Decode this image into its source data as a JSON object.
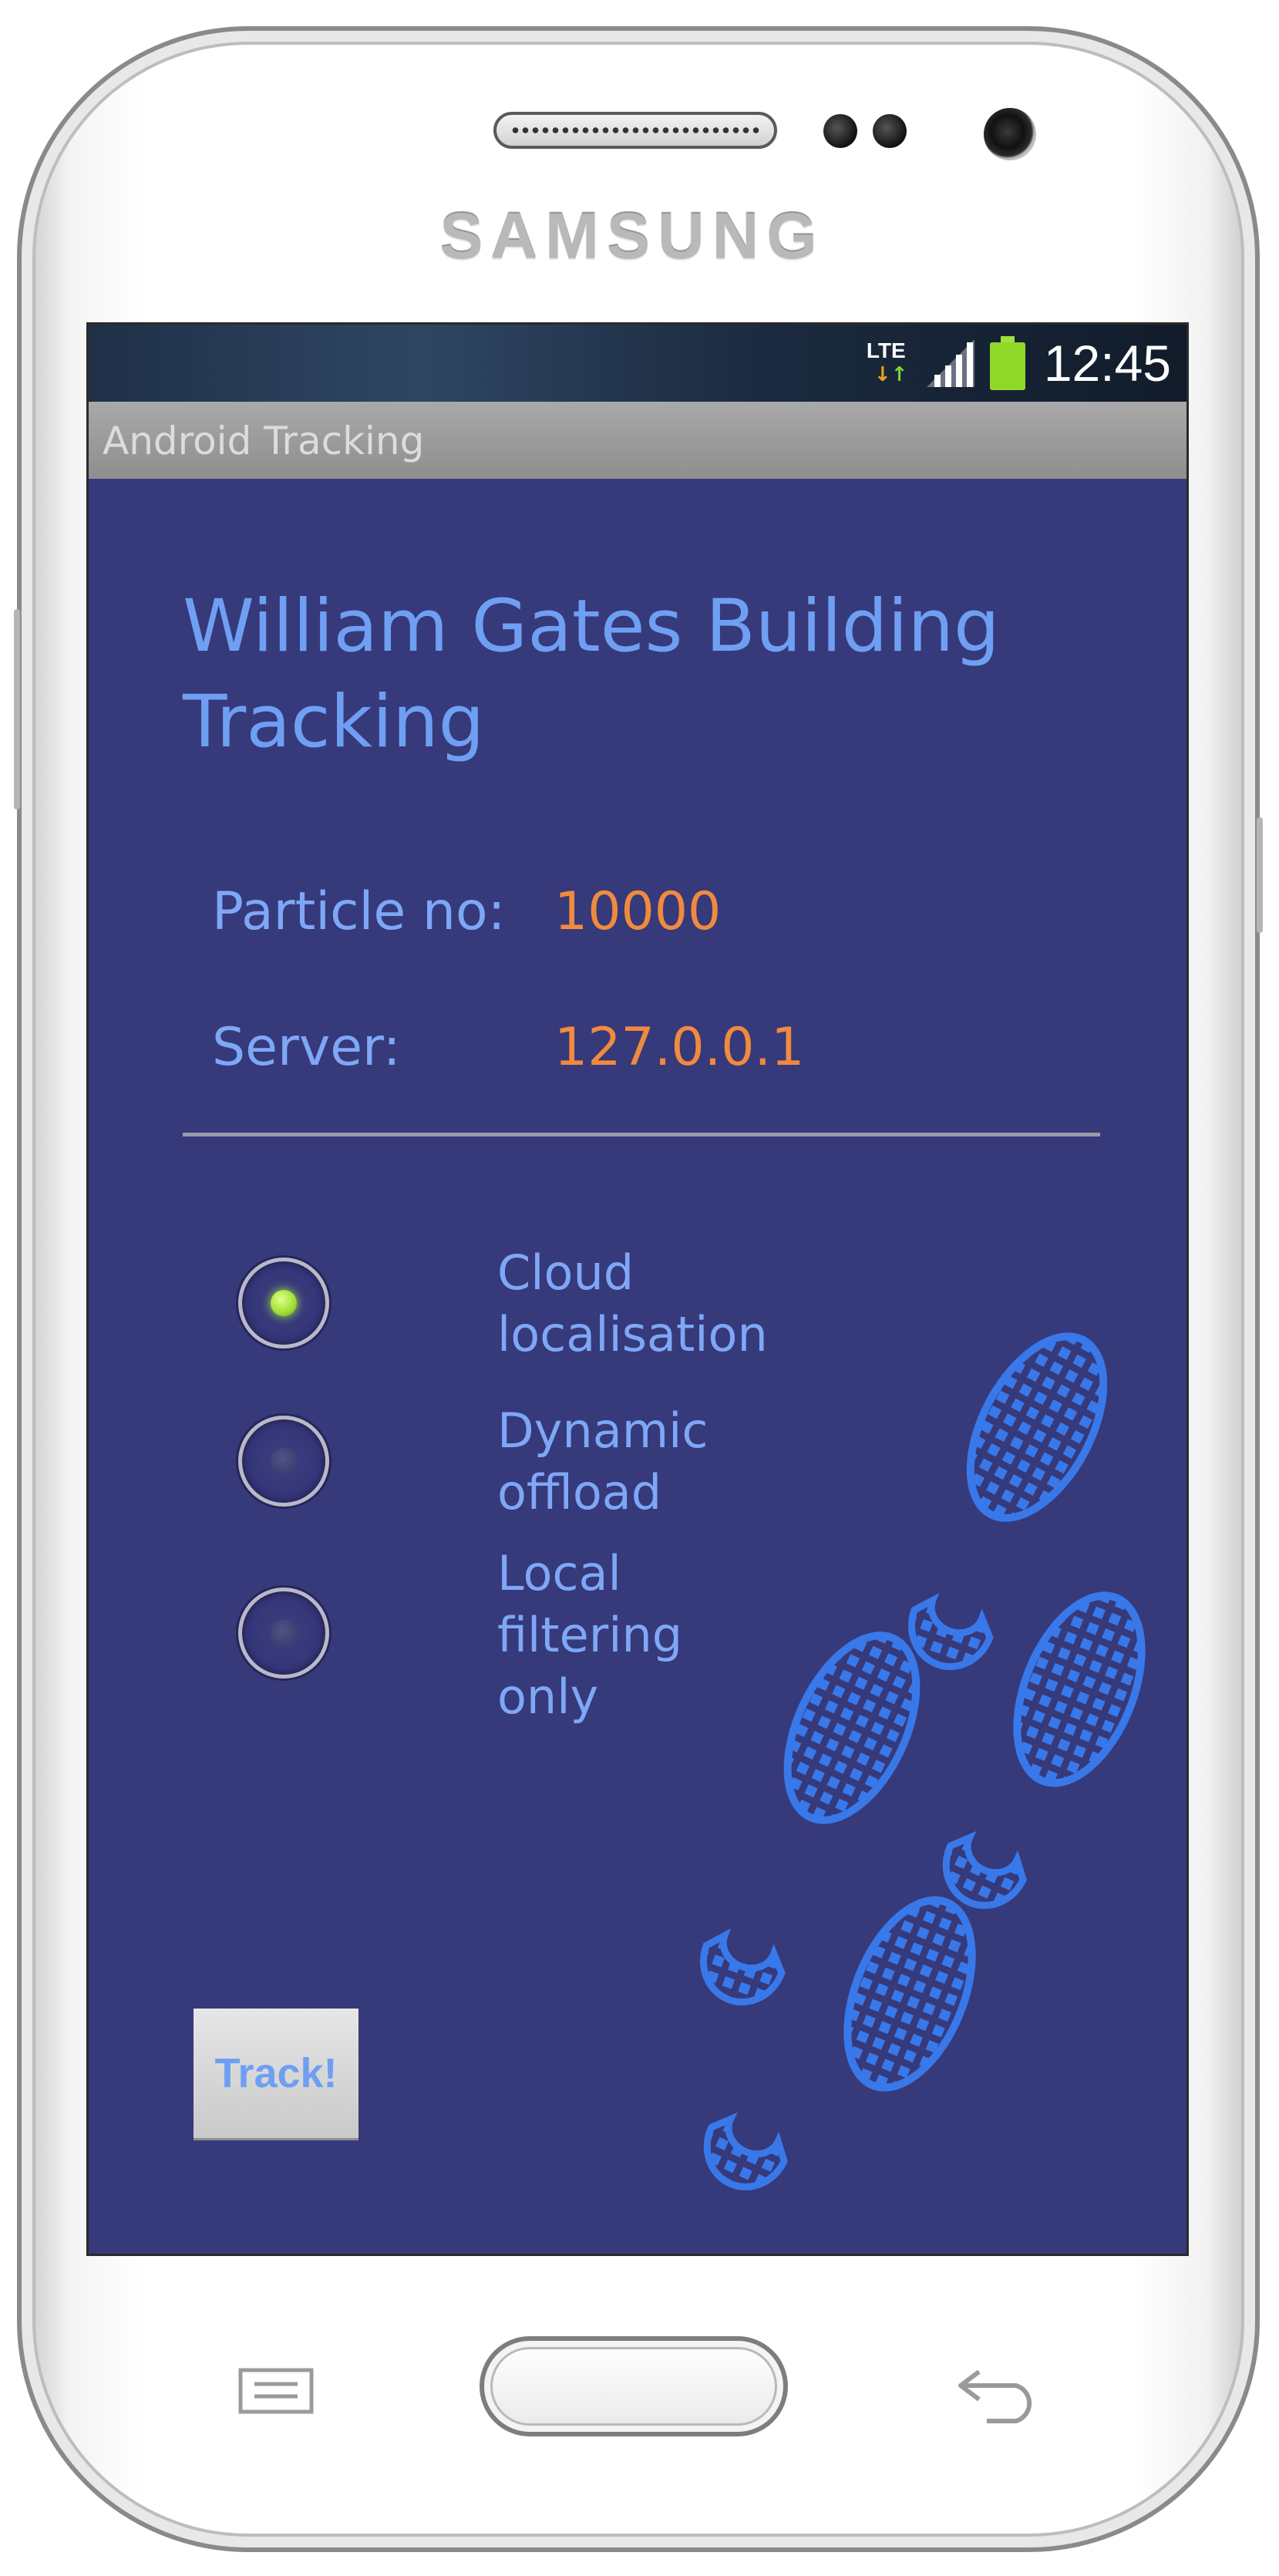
{
  "device": {
    "brand": "SAMSUNG"
  },
  "status_bar": {
    "network_type": "LTE",
    "time": "12:45",
    "icons": [
      "lte-icon",
      "signal-icon",
      "battery-icon"
    ],
    "battery_color": "#8fd82a"
  },
  "app_bar": {
    "title": "Android Tracking"
  },
  "main": {
    "heading_line1": "William Gates Building",
    "heading_line2": "Tracking",
    "fields": [
      {
        "label": "Particle no:",
        "value": "10000"
      },
      {
        "label": "Server:",
        "value": "127.0.0.1"
      }
    ],
    "options": [
      {
        "line1": "Cloud",
        "line2": "localisation",
        "line3": "",
        "checked": true
      },
      {
        "line1": "Dynamic",
        "line2": "offload",
        "line3": "",
        "checked": false
      },
      {
        "line1": "Local",
        "line2": "filtering",
        "line3": "only",
        "checked": false
      }
    ],
    "track_button": "Track!"
  },
  "hardware_keys": {
    "icons": [
      "menu-icon",
      "home-button",
      "back-icon"
    ]
  },
  "colors": {
    "screen_background": "#36397a",
    "label_text": "#7ea7f6",
    "heading_text": "#6f9ff3",
    "value_text": "#f08a3e",
    "radio_checked": "#a3e23a",
    "footprints": "#3a7cf0"
  }
}
